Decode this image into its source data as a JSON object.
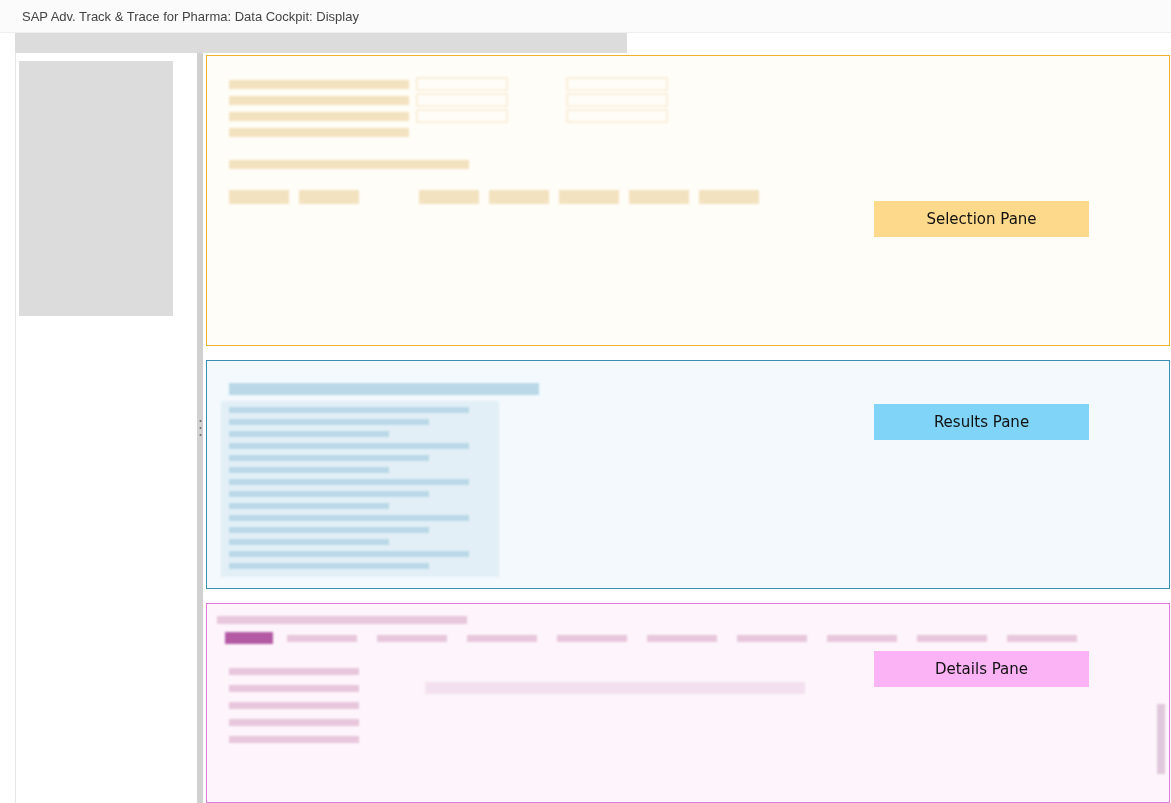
{
  "window": {
    "title": "SAP Adv. Track & Trace for Pharma: Data Cockpit: Display"
  },
  "panes": [
    {
      "kind": "selection",
      "label": "Selection Pane"
    },
    {
      "kind": "results",
      "label": "Results Pane"
    },
    {
      "kind": "details",
      "label": "Details Pane"
    }
  ]
}
